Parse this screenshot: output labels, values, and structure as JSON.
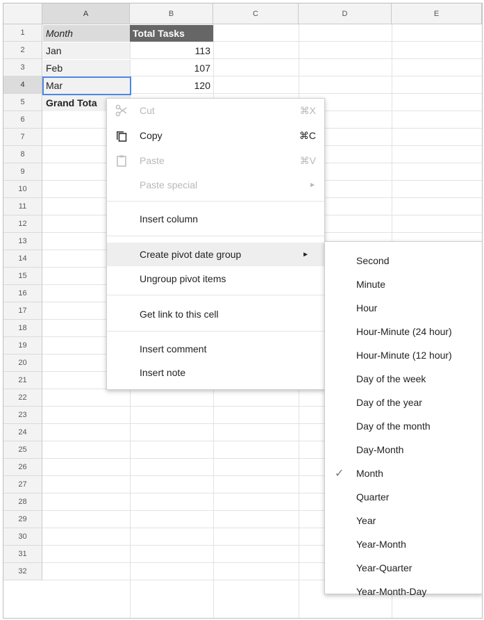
{
  "columns": [
    "A",
    "B",
    "C",
    "D",
    "E"
  ],
  "rows": [
    "1",
    "2",
    "3",
    "4",
    "5",
    "6",
    "7",
    "8",
    "9",
    "10",
    "11",
    "12",
    "13",
    "14",
    "15",
    "16",
    "17",
    "18",
    "19",
    "20",
    "21",
    "22",
    "23",
    "24",
    "25",
    "26",
    "27",
    "28",
    "29",
    "30",
    "31",
    "32"
  ],
  "cells": {
    "a1": "Month",
    "b1": "Total Tasks",
    "a2": "Jan",
    "b2": "113",
    "a3": "Feb",
    "b3": "107",
    "a4": "Mar",
    "b4": "120",
    "a5": "Grand Tota"
  },
  "context_menu": {
    "cut": {
      "label": "Cut",
      "shortcut": "⌘X",
      "icon": "scissors-icon",
      "enabled": false
    },
    "copy": {
      "label": "Copy",
      "shortcut": "⌘C",
      "icon": "copy-icon",
      "enabled": true
    },
    "paste": {
      "label": "Paste",
      "shortcut": "⌘V",
      "icon": "clipboard-icon",
      "enabled": false
    },
    "paste_special": {
      "label": "Paste special",
      "arrow": "►",
      "enabled": false
    },
    "insert_column": {
      "label": "Insert column"
    },
    "create_pivot": {
      "label": "Create pivot date group",
      "arrow": "►",
      "highlighted": true
    },
    "ungroup": {
      "label": "Ungroup pivot items"
    },
    "get_link": {
      "label": "Get link to this cell"
    },
    "insert_comment": {
      "label": "Insert comment"
    },
    "insert_note": {
      "label": "Insert note"
    }
  },
  "submenu": {
    "checkmark": "✓",
    "selected": "Month",
    "items": [
      "Second",
      "Minute",
      "Hour",
      "Hour-Minute (24 hour)",
      "Hour-Minute (12 hour)",
      "Day of the week",
      "Day of the year",
      "Day of the month",
      "Day-Month",
      "Month",
      "Quarter",
      "Year",
      "Year-Month",
      "Year-Quarter",
      "Year-Month-Day"
    ]
  },
  "colors": {
    "selection_border": "#4a86e8",
    "pivot_header_dark": "#666666",
    "pivot_header_light": "#dbdbdb",
    "highlight": "#eeeeee"
  }
}
